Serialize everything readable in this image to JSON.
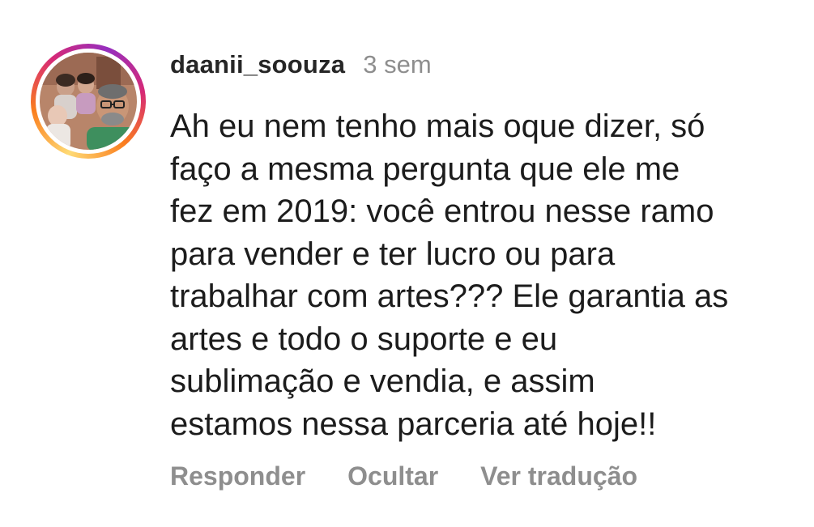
{
  "comment": {
    "username": "daanii_soouza",
    "timestamp": "3 sem",
    "text_lines": [
      "Ah eu nem tenho mais oque dizer, só",
      "faço a mesma pergunta que ele me",
      "fez em 2019: você entrou nesse ramo",
      "para vender e ter lucro ou para",
      "trabalhar com artes??? Ele garantia as",
      "artes e todo o suporte e eu",
      "sublimação e vendia, e assim",
      "estamos nessa parceria até hoje!!"
    ],
    "actions": {
      "reply": "Responder",
      "hide": "Ocultar",
      "translate": "Ver tradução"
    }
  },
  "colors": {
    "text": "#1c1c1c",
    "secondary": "#8e8e8e",
    "story_ring": [
      "#feda75",
      "#fa7e1e",
      "#d62976",
      "#962fbf"
    ]
  }
}
